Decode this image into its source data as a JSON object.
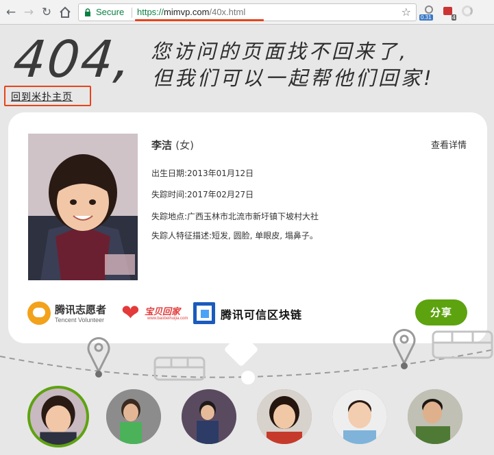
{
  "browser": {
    "secure_label": "Secure",
    "url_protocol": "https://",
    "url_domain": "mimvp.com",
    "url_path": "/40x.html",
    "ext1_badge": "0.31",
    "ext2_badge": "4",
    "icons": [
      "back-arrow-icon",
      "forward-arrow-icon",
      "reload-icon",
      "home-icon",
      "lock-icon",
      "bookmark-star-icon"
    ]
  },
  "header": {
    "code": "404,",
    "line1": "您访问的页面找不回来了,",
    "line2": "但我们可以一起帮他们回家!",
    "home_link": "回到米扑主页"
  },
  "card": {
    "name": "李洁",
    "gender": "(女)",
    "detail_link": "查看详情",
    "fields": [
      {
        "key": "出生日期:",
        "value": "2013年01月12日"
      },
      {
        "key": "失踪时间:",
        "value": "2017年02月27日"
      },
      {
        "key": "失踪地点:",
        "value": "广西玉林市北流市新圩镇下坡村大社"
      },
      {
        "key": "失踪人特征描述:",
        "value": "短发, 圆脸, 单眼皮, 塌鼻子。"
      }
    ],
    "partner_logos": {
      "tencent_volunteer_cn": "腾讯志愿者",
      "tencent_volunteer_en": "Tencent Volunteer",
      "baobei_cn": "宝贝回家",
      "baobei_url": "www.baobeihuijia.com",
      "trust_chain": "腾讯可信区块链"
    },
    "share_button": "分享"
  },
  "colors": {
    "accent_green": "#5da30f",
    "highlight_orange": "#e8431b",
    "page_bg": "#e7e7e7"
  }
}
